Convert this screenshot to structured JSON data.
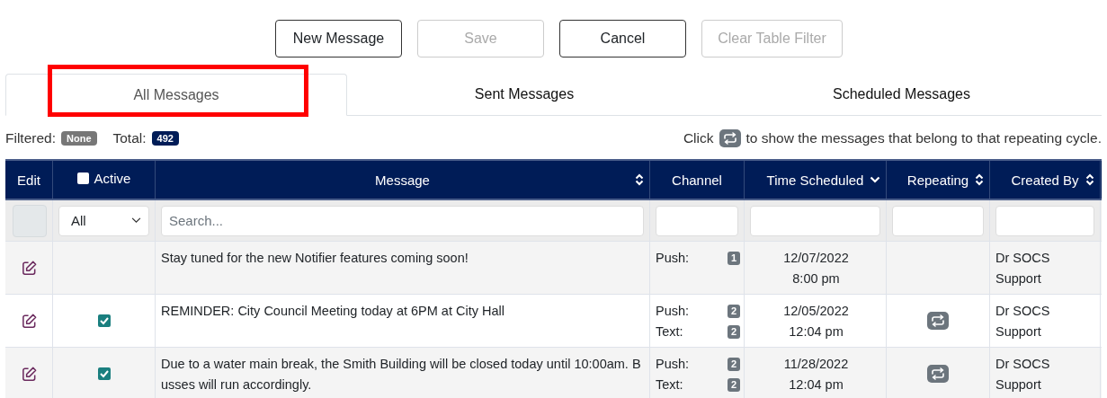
{
  "buttons": [
    {
      "label": "New Message",
      "disabled": false
    },
    {
      "label": "Save",
      "disabled": true
    },
    {
      "label": "Cancel",
      "disabled": false
    },
    {
      "label": "Clear Table Filter",
      "disabled": true
    }
  ],
  "tabs": [
    {
      "label": "All Messages",
      "selected": true,
      "highlighted": true
    },
    {
      "label": "Sent Messages",
      "selected": false,
      "highlighted": false
    },
    {
      "label": "Scheduled Messages",
      "selected": false,
      "highlighted": false
    }
  ],
  "summary": {
    "filtered_label": "Filtered:",
    "filtered_value": "None",
    "total_label": "Total:",
    "total_value": "492",
    "hint_before": "Click",
    "hint_after": "to show the messages that belong to that repeating cycle."
  },
  "table": {
    "columns": [
      {
        "label": "Edit",
        "kind": "plain"
      },
      {
        "label": "Active",
        "kind": "checkbox",
        "checked": false
      },
      {
        "label": "Message",
        "kind": "sortable"
      },
      {
        "label": "Channel",
        "kind": "plain"
      },
      {
        "label": "Time Scheduled",
        "kind": "sorted"
      },
      {
        "label": "Repeating",
        "kind": "sortable"
      },
      {
        "label": "Created By",
        "kind": "sortable"
      }
    ],
    "filters": {
      "active": "All",
      "message_placeholder": "Search..."
    },
    "rows": [
      {
        "checkbox": false,
        "message": "Stay tuned for the new Notifier features coming soon!",
        "channels": [
          {
            "label": "Push:",
            "count": "1"
          }
        ],
        "date": "12/07/2022",
        "time": "8:00 pm",
        "repeating": false,
        "created_by": "Dr SOCS Support"
      },
      {
        "checkbox": true,
        "checked": true,
        "message": "REMINDER: City Council Meeting today at 6PM at City Hall",
        "channels": [
          {
            "label": "Push:",
            "count": "2"
          },
          {
            "label": "Text:",
            "count": "2"
          }
        ],
        "date": "12/05/2022",
        "time": "12:04 pm",
        "repeating": true,
        "created_by": "Dr SOCS Support"
      },
      {
        "checkbox": true,
        "checked": true,
        "message": "Due to a water main break, the Smith Building will be closed today until 10:00am. Busses will run accordingly.",
        "channels": [
          {
            "label": "Push:",
            "count": "2"
          },
          {
            "label": "Text:",
            "count": "2"
          }
        ],
        "date": "11/28/2022",
        "time": "12:04 pm",
        "repeating": true,
        "created_by": "Dr SOCS Support"
      }
    ]
  }
}
